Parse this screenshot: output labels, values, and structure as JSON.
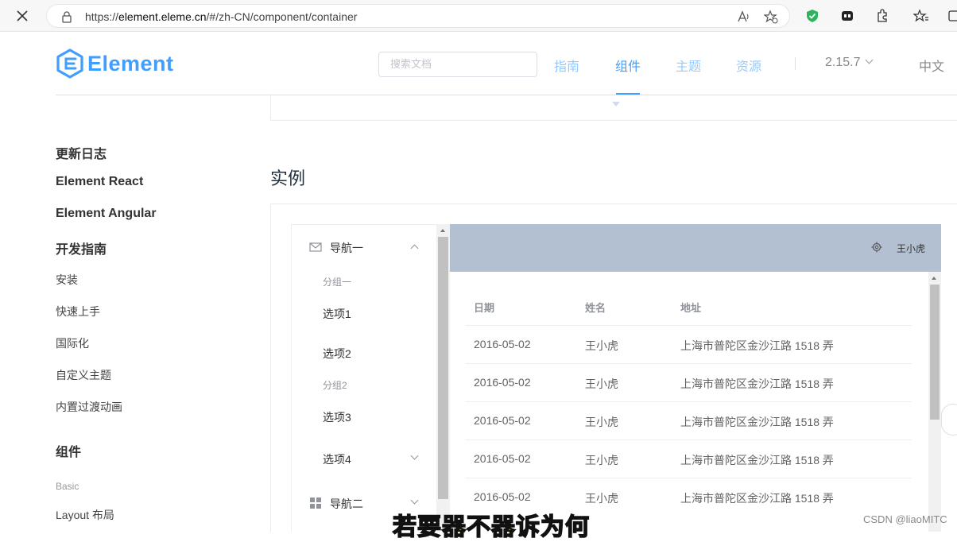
{
  "browser": {
    "url_prefix": "https://",
    "url_host": "element.eleme.cn",
    "url_path": "/#/zh-CN/component/container"
  },
  "site": {
    "logo_text": "Element",
    "search_placeholder": "搜索文档",
    "nav": [
      "指南",
      "组件",
      "主题",
      "资源"
    ],
    "active_nav": "组件",
    "version": "2.15.7",
    "language": "中文"
  },
  "sidebar": {
    "items": [
      {
        "label": "更新日志",
        "kind": "heading"
      },
      {
        "label": "Element React",
        "kind": "heading"
      },
      {
        "label": "Element Angular",
        "kind": "heading"
      },
      {
        "label": "开发指南",
        "kind": "heading"
      },
      {
        "label": "安装",
        "kind": "link"
      },
      {
        "label": "快速上手",
        "kind": "link"
      },
      {
        "label": "国际化",
        "kind": "link"
      },
      {
        "label": "自定义主题",
        "kind": "link"
      },
      {
        "label": "内置过渡动画",
        "kind": "link"
      },
      {
        "label": "组件",
        "kind": "heading"
      },
      {
        "label": "Basic",
        "kind": "group"
      },
      {
        "label": "Layout 布局",
        "kind": "link"
      }
    ]
  },
  "content": {
    "section_title": "实例"
  },
  "demo": {
    "menu": {
      "nav1": "导航一",
      "group1": "分组一",
      "opt1": "选项1",
      "opt2": "选项2",
      "group2": "分组2",
      "opt3": "选项3",
      "opt4": "选项4",
      "nav2": "导航二"
    },
    "header_user": "王小虎",
    "table": {
      "columns": [
        "日期",
        "姓名",
        "地址"
      ],
      "rows": [
        [
          "2016-05-02",
          "王小虎",
          "上海市普陀区金沙江路 1518 弄"
        ],
        [
          "2016-05-02",
          "王小虎",
          "上海市普陀区金沙江路 1518 弄"
        ],
        [
          "2016-05-02",
          "王小虎",
          "上海市普陀区金沙江路 1518 弄"
        ],
        [
          "2016-05-02",
          "王小虎",
          "上海市普陀区金沙江路 1518 弄"
        ],
        [
          "2016-05-02",
          "王小虎",
          "上海市普陀区金沙江路 1518 弄"
        ]
      ]
    }
  },
  "overlay": {
    "caption": "若要器不器诉为何",
    "watermark": "CSDN @liaoMITC"
  },
  "colors": {
    "brand": "#409eff",
    "header_bg": "#b3c0d1"
  }
}
